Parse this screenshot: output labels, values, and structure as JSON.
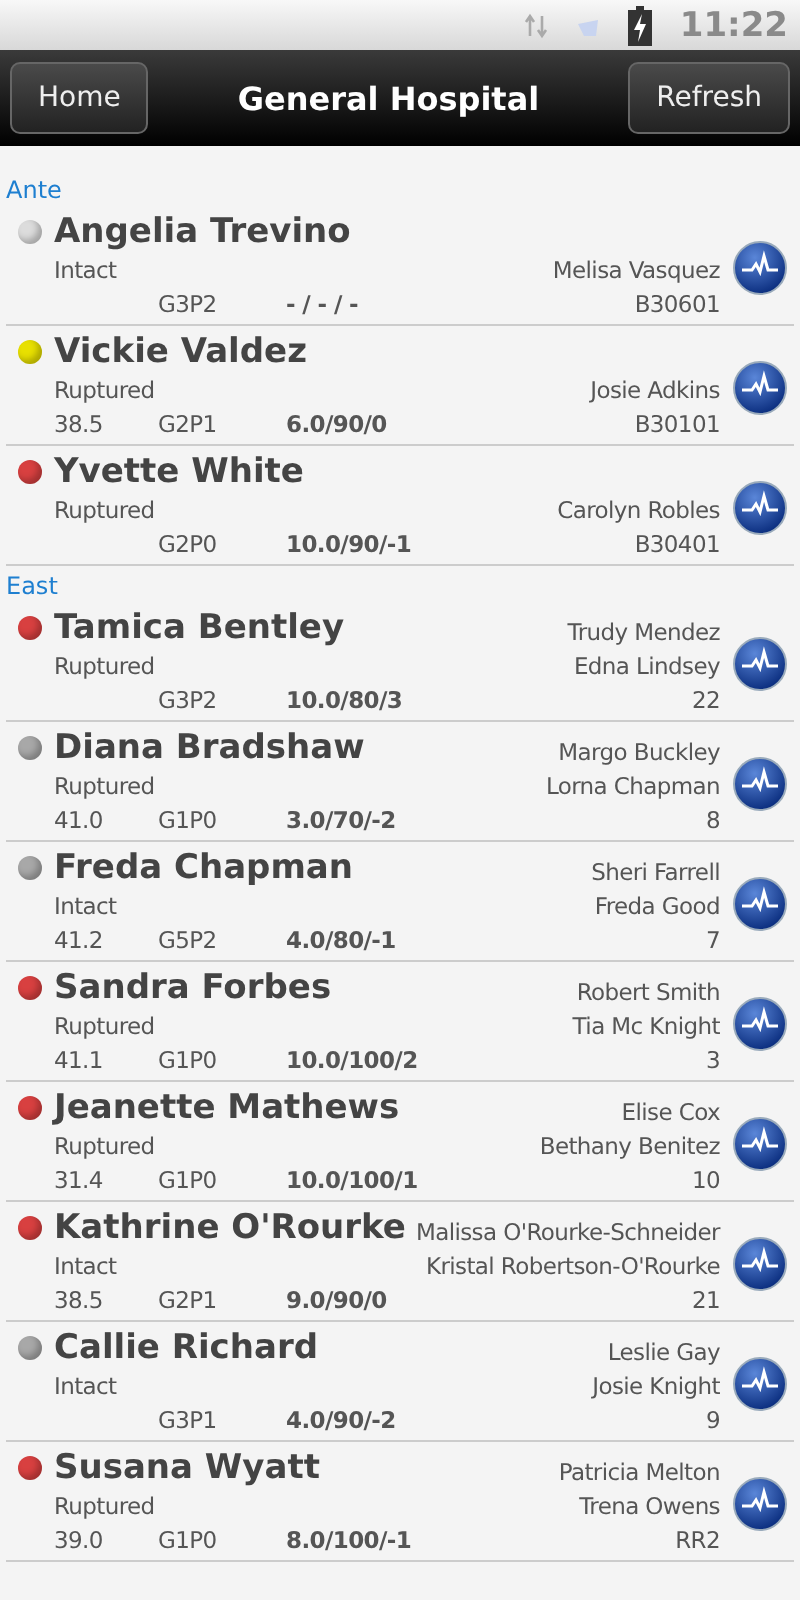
{
  "status_bar": {
    "time": "11:22"
  },
  "header": {
    "title": "General Hospital",
    "left_button": "Home",
    "right_button": "Refresh"
  },
  "sections": [
    {
      "label": "Ante",
      "patients": [
        {
          "name": "Angelia Trevino",
          "color": "#dcdcdc",
          "membranes": "Intact",
          "nurses": [
            "Melisa Vasquez"
          ],
          "gp": "G3P2",
          "exam": "- / - / -",
          "bed": "B30601"
        },
        {
          "name": "Vickie Valdez",
          "color": "#e8e000",
          "membranes": "Ruptured",
          "nurses": [
            "Josie Adkins"
          ],
          "ga": "38.5",
          "gp": "G2P1",
          "exam": "6.0/90/0",
          "bed": "B30101"
        },
        {
          "name": "Yvette White",
          "color": "#d84040",
          "membranes": "Ruptured",
          "nurses": [
            "Carolyn Robles"
          ],
          "gp": "G2P0",
          "exam": "10.0/90/-1",
          "bed": "B30401"
        }
      ]
    },
    {
      "label": "East",
      "patients": [
        {
          "name": "Tamica Bentley",
          "color": "#d84040",
          "membranes": "Ruptured",
          "nurses": [
            "Trudy Mendez",
            "Edna Lindsey"
          ],
          "gp": "G3P2",
          "exam": "10.0/80/3",
          "bed": "22"
        },
        {
          "name": "Diana Bradshaw",
          "color": "#a8a8a8",
          "membranes": "Ruptured",
          "nurses": [
            "Margo Buckley",
            "Lorna Chapman"
          ],
          "ga": "41.0",
          "gp": "G1P0",
          "exam": "3.0/70/-2",
          "bed": "8"
        },
        {
          "name": "Freda Chapman",
          "color": "#a8a8a8",
          "membranes": "Intact",
          "nurses": [
            "Sheri Farrell",
            "Freda Good"
          ],
          "ga": "41.2",
          "gp": "G5P2",
          "exam": "4.0/80/-1",
          "bed": "7"
        },
        {
          "name": "Sandra Forbes",
          "color": "#d84040",
          "membranes": "Ruptured",
          "nurses": [
            "Robert Smith",
            "Tia Mc Knight"
          ],
          "ga": "41.1",
          "gp": "G1P0",
          "exam": "10.0/100/2",
          "bed": "3"
        },
        {
          "name": "Jeanette Mathews",
          "color": "#d84040",
          "membranes": "Ruptured",
          "nurses": [
            "Elise Cox",
            "Bethany Benitez"
          ],
          "ga": "31.4",
          "gp": "G1P0",
          "exam": "10.0/100/1",
          "bed": "10"
        },
        {
          "name": "Kathrine O'Rourke",
          "color": "#d84040",
          "membranes": "Intact",
          "nurses": [
            "Malissa O'Rourke-Schneider",
            "Kristal Robertson-O'Rourke"
          ],
          "ga": "38.5",
          "gp": "G2P1",
          "exam": "9.0/90/0",
          "bed": "21"
        },
        {
          "name": "Callie Richard",
          "color": "#a8a8a8",
          "membranes": "Intact",
          "nurses": [
            "Leslie Gay",
            "Josie Knight"
          ],
          "gp": "G3P1",
          "exam": "4.0/90/-2",
          "bed": "9"
        },
        {
          "name": "Susana Wyatt",
          "color": "#d84040",
          "membranes": "Ruptured",
          "nurses": [
            "Patricia Melton",
            "Trena Owens"
          ],
          "ga": "39.0",
          "gp": "G1P0",
          "exam": "8.0/100/-1",
          "bed": "RR2"
        }
      ]
    }
  ]
}
